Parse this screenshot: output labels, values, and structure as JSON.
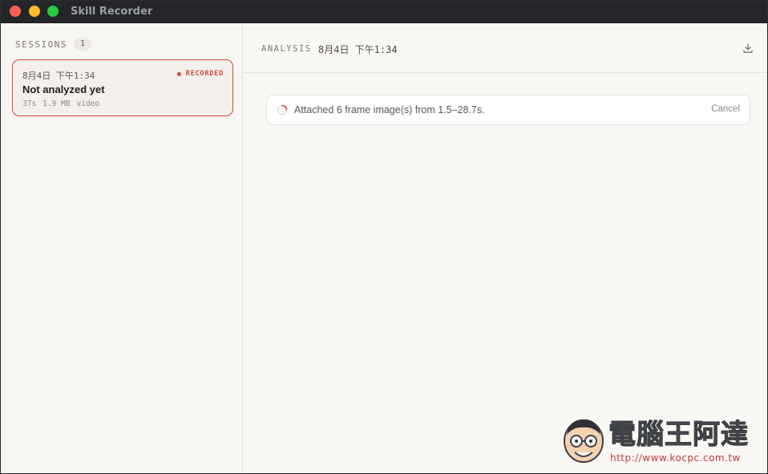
{
  "window": {
    "title": "Skill Recorder"
  },
  "sidebar": {
    "sessions_label": "SESSIONS",
    "sessions_count": "1",
    "sessions": [
      {
        "date": "8月4日 下午1:34",
        "status": "RECORDED",
        "title": "Not analyzed yet",
        "duration": "37s",
        "size": "1.9 MB",
        "type": "video"
      }
    ]
  },
  "main": {
    "analysis_label": "ANALYSIS",
    "analysis_date": "8月4日 下午1:34",
    "progress_text": "Attached 6 frame image(s) from 1.5–28.7s.",
    "cancel_label": "Cancel"
  },
  "watermark": {
    "brand": "電腦王阿達",
    "url": "http://www.kocpc.com.tw"
  },
  "colors": {
    "accent": "#d9473a",
    "background": "#faf8f5",
    "titlebar": "#232528"
  },
  "icons": {
    "download": "download-icon",
    "spinner": "spinner-icon"
  }
}
